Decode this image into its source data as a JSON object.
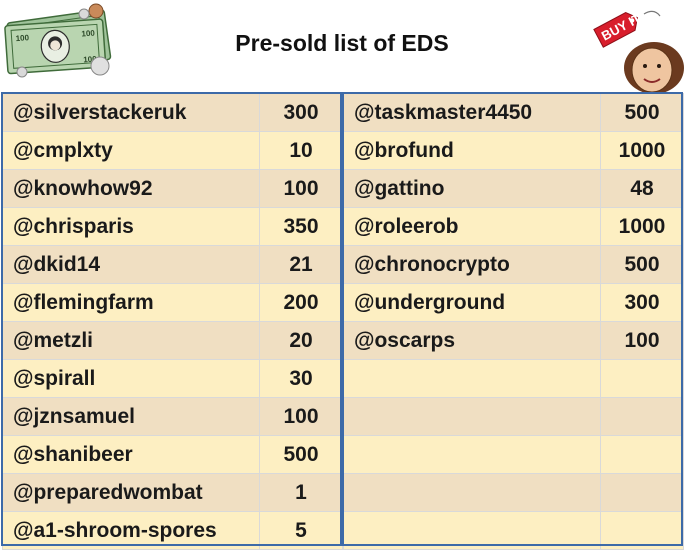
{
  "title": "Pre-sold list of EDS",
  "decorations": {
    "left_icon": "money-banknotes-coins-icon",
    "right_icon": "buy-it-tag-icon",
    "buy_it_text": "BUY IT"
  },
  "colors": {
    "row_odd": "#f0dfc2",
    "row_even": "#fdefc2",
    "frame": "#3d6aa8"
  },
  "left_table": [
    {
      "name": "@silverstackeruk",
      "qty": "300"
    },
    {
      "name": "@cmplxty",
      "qty": "10"
    },
    {
      "name": "@knowhow92",
      "qty": "100"
    },
    {
      "name": "@chrisparis",
      "qty": "350"
    },
    {
      "name": "@dkid14",
      "qty": "21"
    },
    {
      "name": "@flemingfarm",
      "qty": "200"
    },
    {
      "name": "@metzli",
      "qty": "20"
    },
    {
      "name": "@spirall",
      "qty": "30"
    },
    {
      "name": "@jznsamuel",
      "qty": "100"
    },
    {
      "name": "@shanibeer",
      "qty": "500"
    },
    {
      "name": "@preparedwombat",
      "qty": "1"
    },
    {
      "name": "@a1-shroom-spores",
      "qty": "5"
    }
  ],
  "right_table": [
    {
      "name": "@taskmaster4450",
      "qty": "500"
    },
    {
      "name": "@brofund",
      "qty": "1000"
    },
    {
      "name": "@gattino",
      "qty": "48"
    },
    {
      "name": "@roleerob",
      "qty": "1000"
    },
    {
      "name": "@chronocrypto",
      "qty": "500"
    },
    {
      "name": "@underground",
      "qty": "300"
    },
    {
      "name": "@oscarps",
      "qty": "100"
    },
    {
      "name": "",
      "qty": ""
    },
    {
      "name": "",
      "qty": ""
    },
    {
      "name": "",
      "qty": ""
    },
    {
      "name": "",
      "qty": ""
    },
    {
      "name": "",
      "qty": ""
    }
  ]
}
